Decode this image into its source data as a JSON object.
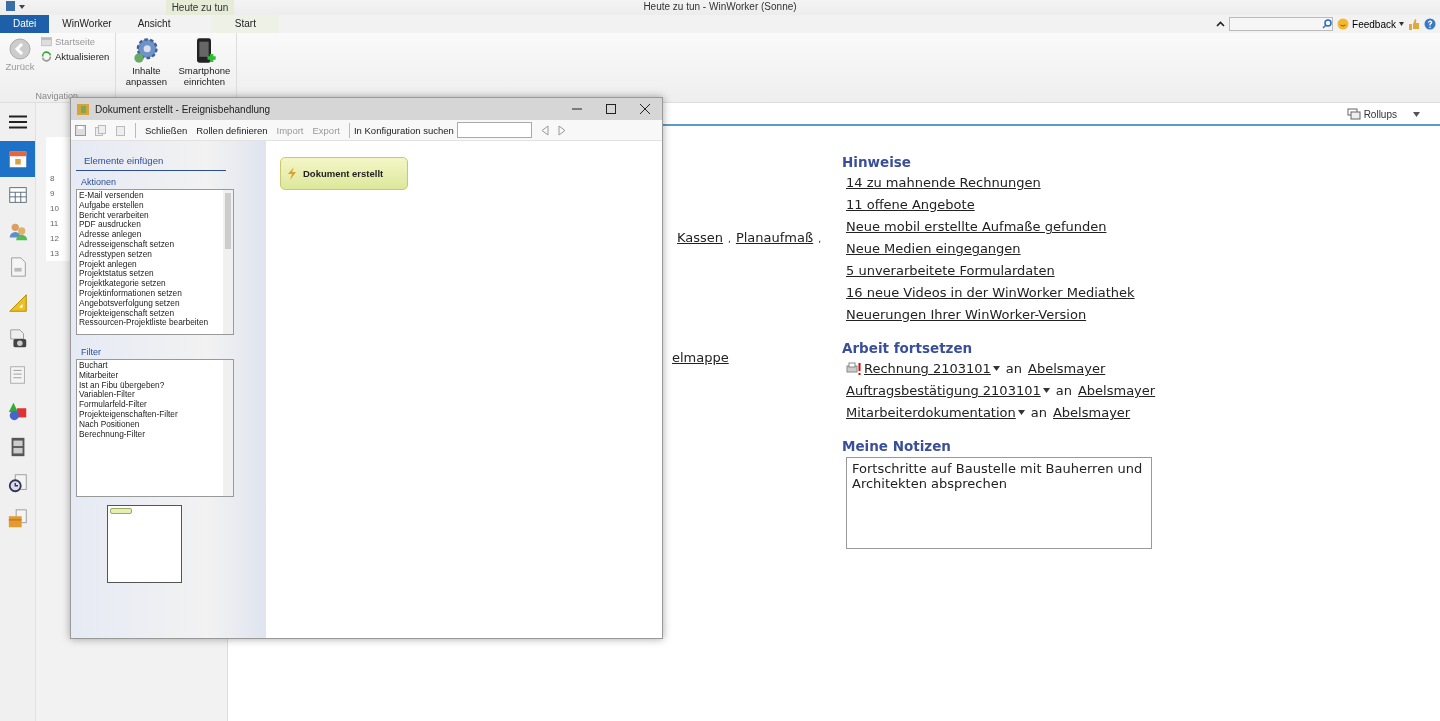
{
  "app_title": "Heute zu tun - WinWorker (Sonne)",
  "contextual_tab_group": "Heute zu tun",
  "ribbon_tabs": [
    {
      "label": "Datei",
      "selected": true,
      "kind": "file"
    },
    {
      "label": "WinWorker",
      "selected": false,
      "kind": "tab"
    },
    {
      "label": "Ansicht",
      "selected": false,
      "kind": "tab"
    },
    {
      "label": "Start",
      "selected": false,
      "kind": "contextual"
    }
  ],
  "feedback": "Feedback",
  "ribbon_groups": [
    {
      "label": "Navigation",
      "items": [
        {
          "label": "Zurück",
          "kind": "large",
          "disabled": true
        },
        {
          "label": "Startseite",
          "kind": "small",
          "disabled": true
        },
        {
          "label": "Aktualisieren",
          "kind": "small",
          "disabled": false
        }
      ]
    },
    {
      "items": [
        {
          "label": "Inhalte anpassen",
          "kind": "large",
          "disabled": false
        },
        {
          "label": "Smartphone einrichten",
          "kind": "large",
          "disabled": false
        }
      ]
    }
  ],
  "sidebar": {
    "items": [
      {
        "selected": true
      },
      {
        "selected": false
      },
      {
        "selected": false
      },
      {
        "selected": false
      },
      {
        "selected": false
      },
      {
        "selected": false
      },
      {
        "selected": false
      },
      {
        "selected": false
      },
      {
        "selected": false
      },
      {
        "selected": false
      },
      {
        "selected": false
      }
    ]
  },
  "calendar": {
    "week_numbers": [
      "8",
      "9",
      "10",
      "11",
      "12",
      "13"
    ]
  },
  "rollups": "Rollups",
  "left_links": {
    "links": [
      "Kassen",
      "Planaufmaß"
    ],
    "separator": ",",
    "cut_link": "elmappe"
  },
  "hinweise": {
    "title": "Hinweise",
    "links": [
      "14 zu mahnende Rechnungen",
      "11 offene Angebote",
      "Neue mobil erstellte Aufmaße gefunden",
      "Neue Medien eingegangen",
      "5 unverarbeitete Formulardaten",
      "16 neue Videos in der WinWorker Mediathek",
      "Neuerungen Ihrer WinWorker-Version"
    ]
  },
  "arbeit": {
    "title": "Arbeit fortsetzen",
    "items": [
      {
        "document": "Rechnung 2103101",
        "connector": "an",
        "recipient": "Abelsmayer",
        "printer_flag": true
      },
      {
        "document": "Auftragsbestätigung 2103101",
        "connector": "an",
        "recipient": "Abelsmayer",
        "printer_flag": false
      },
      {
        "document": "Mitarbeiterdokumentation",
        "connector": "an",
        "recipient": "Abelsmayer",
        "printer_flag": false
      }
    ]
  },
  "notizen": {
    "title": "Meine Notizen",
    "value": "Fortschritte auf Baustelle mit Bauherren und Architekten absprechen"
  },
  "dialog": {
    "title": "Dokument erstellt - Ereignisbehandlung",
    "toolbar": [
      {
        "label": "Schließen",
        "disabled": false
      },
      {
        "label": "Rollen definieren",
        "disabled": false
      },
      {
        "label": "Import",
        "disabled": true
      },
      {
        "label": "Export",
        "disabled": true
      }
    ],
    "search_label": "In Konfiguration suchen",
    "panel_title": "Elemente einfügen",
    "actions": {
      "title": "Aktionen",
      "items": [
        "E-Mail versenden",
        "Aufgabe erstellen",
        "Bericht verarbeiten",
        "PDF ausdrucken",
        "Adresse anlegen",
        "Adresseigenschaft setzen",
        "Adresstypen setzen",
        "Projekt anlegen",
        "Projektstatus setzen",
        "Projektkategorie setzen",
        "Projektinformationen setzen",
        "Angebotsverfolgung setzen",
        "Projekteigenschaft setzen",
        "Ressourcen-Projektliste bearbeiten"
      ]
    },
    "filter": {
      "title": "Filter",
      "items": [
        "Buchart",
        "Mitarbeiter",
        "Ist an Fibu übergeben?",
        "Variablen-Filter",
        "Formularfeld-Filter",
        "Projekteigenschaften-Filter",
        "Nach Positionen",
        "Berechnung-Filter"
      ]
    },
    "node": "Dokument erstellt"
  }
}
